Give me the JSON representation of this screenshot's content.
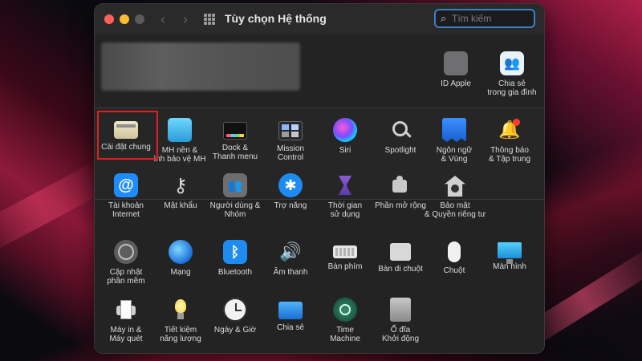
{
  "window": {
    "title": "Tùy chọn Hệ thống",
    "search_placeholder": "Tìm kiếm"
  },
  "account": {
    "apple_id_label": "ID Apple",
    "family_label": "Chia sẻ\ntrong gia đình"
  },
  "row1": [
    {
      "label": "Cài đặt chung",
      "icon": "general-icon"
    },
    {
      "label": "MH nền &\nình bảo vệ MH",
      "icon": "desktop-screensaver-icon"
    },
    {
      "label": "Dock &\nThanh menu",
      "icon": "dock-icon"
    },
    {
      "label": "Mission\nControl",
      "icon": "mission-control-icon"
    },
    {
      "label": "Siri",
      "icon": "siri-icon"
    },
    {
      "label": "Spotlight",
      "icon": "spotlight-icon"
    },
    {
      "label": "Ngôn ngữ\n& Vùng",
      "icon": "language-region-icon"
    },
    {
      "label": "Thông báo\n& Tập trung",
      "icon": "notifications-icon"
    }
  ],
  "row2": [
    {
      "label": "Tài khoản\nInternet",
      "icon": "internet-accounts-icon"
    },
    {
      "label": "Mật khẩu",
      "icon": "passwords-icon"
    },
    {
      "label": "Người dùng &\nNhóm",
      "icon": "users-groups-icon"
    },
    {
      "label": "Trợ năng",
      "icon": "accessibility-icon"
    },
    {
      "label": "Thời gian\nsử dụng",
      "icon": "screen-time-icon"
    },
    {
      "label": "Phần mở rộng",
      "icon": "extensions-icon"
    },
    {
      "label": "Bảo mật\n& Quyền riêng tư",
      "icon": "security-privacy-icon"
    }
  ],
  "row3": [
    {
      "label": "Cập nhật\nphần mềm",
      "icon": "software-update-icon"
    },
    {
      "label": "Mạng",
      "icon": "network-icon"
    },
    {
      "label": "Bluetooth",
      "icon": "bluetooth-icon"
    },
    {
      "label": "Âm thanh",
      "icon": "sound-icon"
    },
    {
      "label": "Bàn phím",
      "icon": "keyboard-icon"
    },
    {
      "label": "Bàn di chuột",
      "icon": "trackpad-icon"
    },
    {
      "label": "Chuột",
      "icon": "mouse-icon"
    },
    {
      "label": "Màn hình",
      "icon": "displays-icon"
    }
  ],
  "row4": [
    {
      "label": "Máy in &\nMáy quét",
      "icon": "printers-scanners-icon"
    },
    {
      "label": "Tiết kiệm\nnăng lượng",
      "icon": "energy-saver-icon"
    },
    {
      "label": "Ngày & Giờ",
      "icon": "date-time-icon"
    },
    {
      "label": "Chia sẻ",
      "icon": "sharing-icon"
    },
    {
      "label": "Time\nMachine",
      "icon": "time-machine-icon"
    },
    {
      "label": "Ổ đĩa\nKhởi động",
      "icon": "startup-disk-icon"
    }
  ],
  "colors": {
    "highlight": "#e02020",
    "search_focus": "#3d7fc9"
  }
}
